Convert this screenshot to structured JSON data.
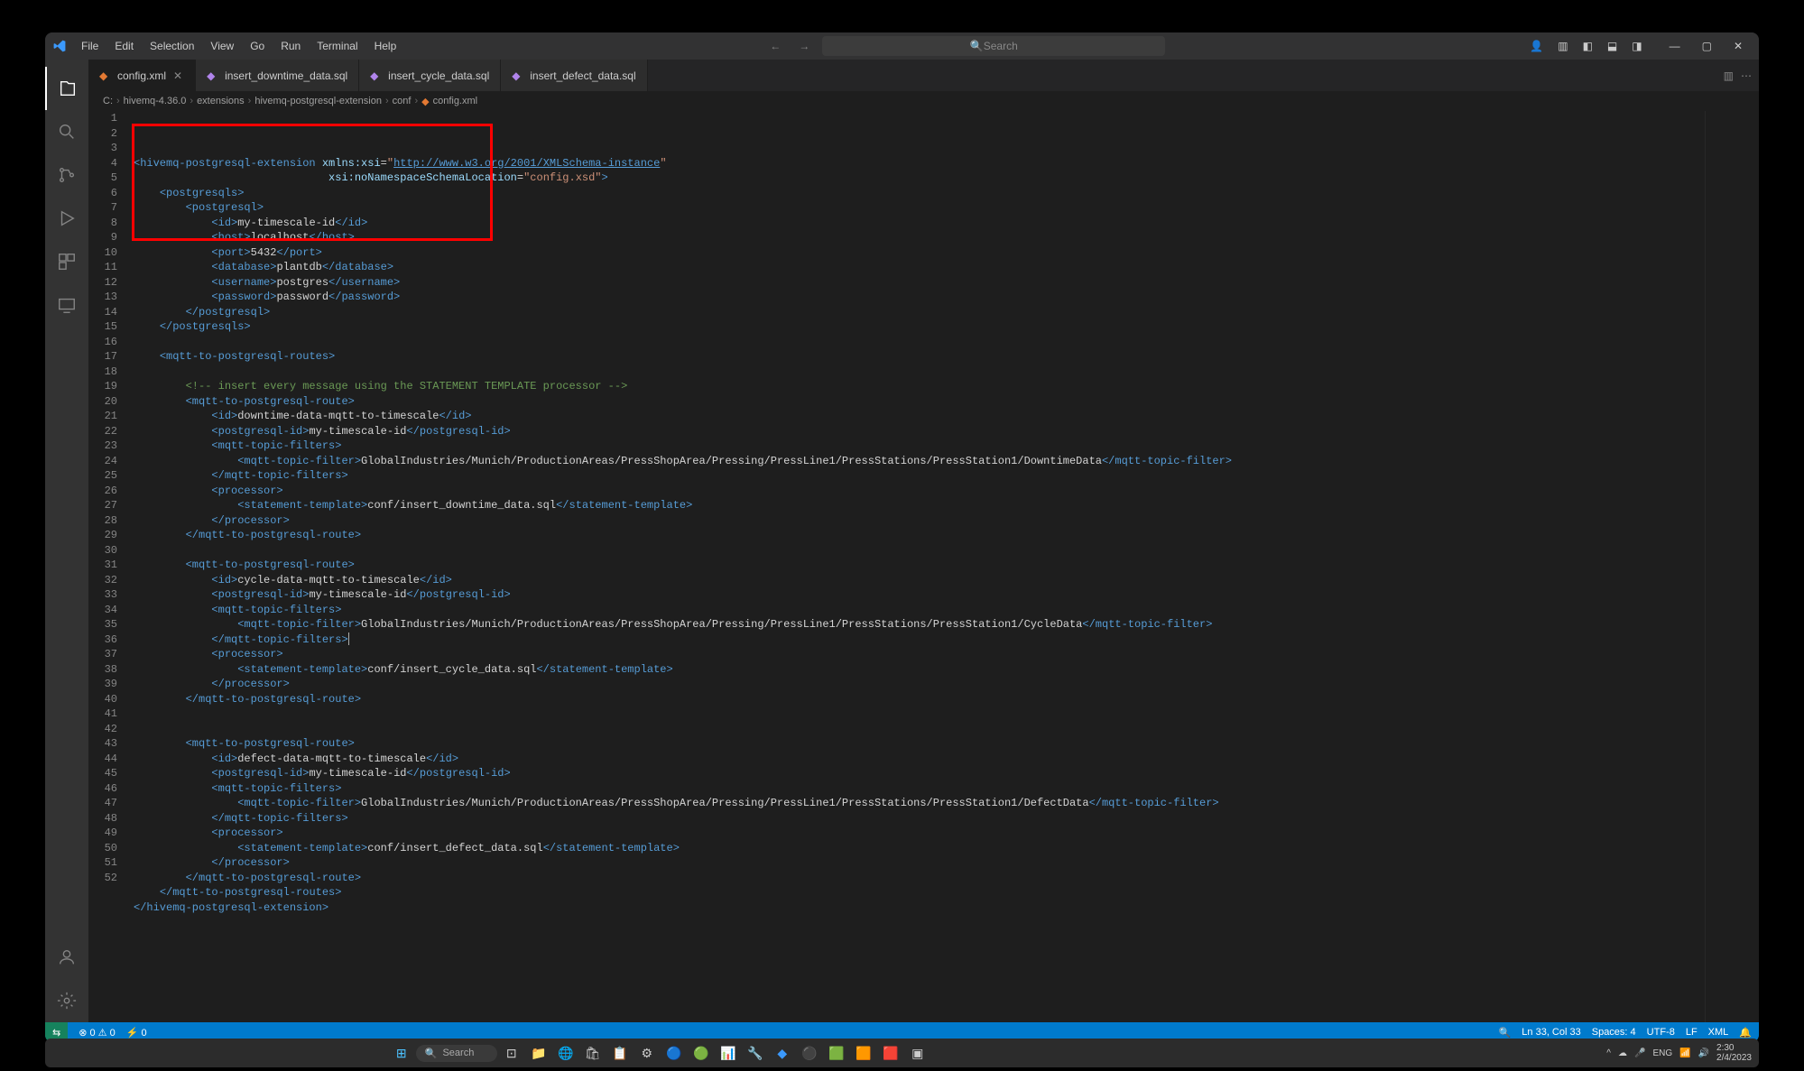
{
  "menu": [
    "File",
    "Edit",
    "Selection",
    "View",
    "Go",
    "Run",
    "Terminal",
    "Help"
  ],
  "search_placeholder": "Search",
  "tabs": [
    {
      "name": "config.xml",
      "active": true,
      "type": "xml"
    },
    {
      "name": "insert_downtime_data.sql",
      "active": false,
      "type": "sql"
    },
    {
      "name": "insert_cycle_data.sql",
      "active": false,
      "type": "sql"
    },
    {
      "name": "insert_defect_data.sql",
      "active": false,
      "type": "sql"
    }
  ],
  "breadcrumb": [
    "C:",
    "hivemq-4.36.0",
    "extensions",
    "hivemq-postgresql-extension",
    "conf",
    "config.xml"
  ],
  "code": {
    "root_tag": "hivemq-postgresql-extension",
    "xmlns_attr": "xmlns:xsi",
    "xmlns_val": "http://www.w3.org/2001/XMLSchema-instance",
    "schema_attr": "xsi:noNamespaceSchemaLocation",
    "schema_val": "config.xsd",
    "pg": {
      "id": "my-timescale-id",
      "host": "localhost",
      "port": "5432",
      "database": "plantdb",
      "username": "postgres",
      "password": "password"
    },
    "comment": "<!-- insert every message using the STATEMENT TEMPLATE processor -->",
    "routes": [
      {
        "id": "downtime-data-mqtt-to-timescale",
        "pgid": "my-timescale-id",
        "topic": "GlobalIndustries/Munich/ProductionAreas/PressShopArea/Pressing/PressLine1/PressStations/PressStation1/DowntimeData",
        "stmt": "conf/insert_downtime_data.sql"
      },
      {
        "id": "cycle-data-mqtt-to-timescale",
        "pgid": "my-timescale-id",
        "topic": "GlobalIndustries/Munich/ProductionAreas/PressShopArea/Pressing/PressLine1/PressStations/PressStation1/CycleData",
        "stmt": "conf/insert_cycle_data.sql"
      },
      {
        "id": "defect-data-mqtt-to-timescale",
        "pgid": "my-timescale-id",
        "topic": "GlobalIndustries/Munich/ProductionAreas/PressShopArea/Pressing/PressLine1/PressStations/PressStation1/DefectData",
        "stmt": "conf/insert_defect_data.sql"
      }
    ]
  },
  "status": {
    "errors": "0",
    "warnings": "0",
    "ports": "0",
    "ln": "Ln 33, Col 33",
    "spaces": "Spaces: 4",
    "enc": "UTF-8",
    "eol": "LF",
    "lang": "XML"
  },
  "taskbar": {
    "search": "Search",
    "tray": {
      "lang": "ENG",
      "time": "2:30",
      "date": "2/4/2023"
    }
  }
}
